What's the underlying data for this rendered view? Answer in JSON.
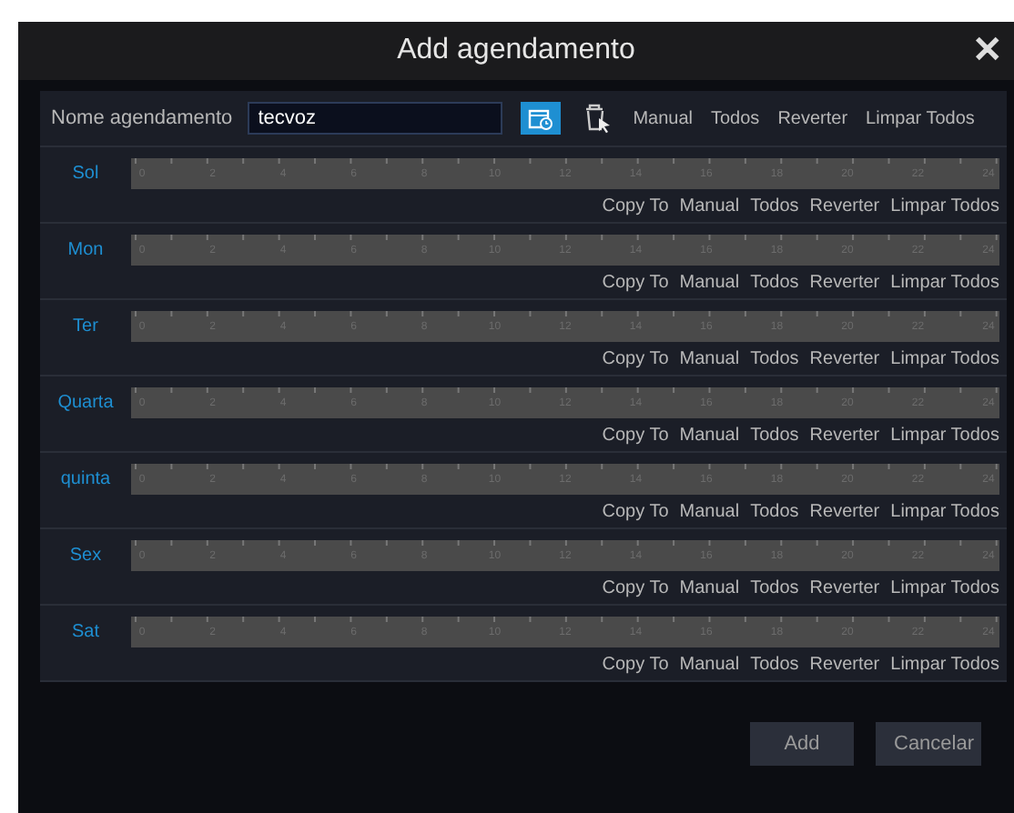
{
  "window": {
    "title": "Add agendamento",
    "close": "✕"
  },
  "toolbar": {
    "name_label": "Nome agendamento",
    "name_value": "tecvoz",
    "actions": [
      "Manual",
      "Todos",
      "Reverter",
      "Limpar Todos"
    ]
  },
  "days": [
    {
      "label": "Sol",
      "hours": [
        "0",
        "2",
        "4",
        "6",
        "8",
        "10",
        "12",
        "14",
        "16",
        "18",
        "20",
        "22",
        "24"
      ],
      "actions": [
        "Copy To",
        "Manual",
        "Todos",
        "Reverter",
        "Limpar Todos"
      ]
    },
    {
      "label": "Mon",
      "hours": [
        "0",
        "2",
        "4",
        "6",
        "8",
        "10",
        "12",
        "14",
        "16",
        "18",
        "20",
        "22",
        "24"
      ],
      "actions": [
        "Copy To",
        "Manual",
        "Todos",
        "Reverter",
        "Limpar Todos"
      ]
    },
    {
      "label": "Ter",
      "hours": [
        "0",
        "2",
        "4",
        "6",
        "8",
        "10",
        "12",
        "14",
        "16",
        "18",
        "20",
        "22",
        "24"
      ],
      "actions": [
        "Copy To",
        "Manual",
        "Todos",
        "Reverter",
        "Limpar Todos"
      ]
    },
    {
      "label": "Quarta",
      "hours": [
        "0",
        "2",
        "4",
        "6",
        "8",
        "10",
        "12",
        "14",
        "16",
        "18",
        "20",
        "22",
        "24"
      ],
      "actions": [
        "Copy To",
        "Manual",
        "Todos",
        "Reverter",
        "Limpar Todos"
      ]
    },
    {
      "label": "quinta",
      "hours": [
        "0",
        "2",
        "4",
        "6",
        "8",
        "10",
        "12",
        "14",
        "16",
        "18",
        "20",
        "22",
        "24"
      ],
      "actions": [
        "Copy To",
        "Manual",
        "Todos",
        "Reverter",
        "Limpar Todos"
      ]
    },
    {
      "label": "Sex",
      "hours": [
        "0",
        "2",
        "4",
        "6",
        "8",
        "10",
        "12",
        "14",
        "16",
        "18",
        "20",
        "22",
        "24"
      ],
      "actions": [
        "Copy To",
        "Manual",
        "Todos",
        "Reverter",
        "Limpar Todos"
      ]
    },
    {
      "label": "Sat",
      "hours": [
        "0",
        "2",
        "4",
        "6",
        "8",
        "10",
        "12",
        "14",
        "16",
        "18",
        "20",
        "22",
        "24"
      ],
      "actions": [
        "Copy To",
        "Manual",
        "Todos",
        "Reverter",
        "Limpar Todos"
      ]
    }
  ],
  "buttons": [
    "Add",
    "Cancelar"
  ]
}
